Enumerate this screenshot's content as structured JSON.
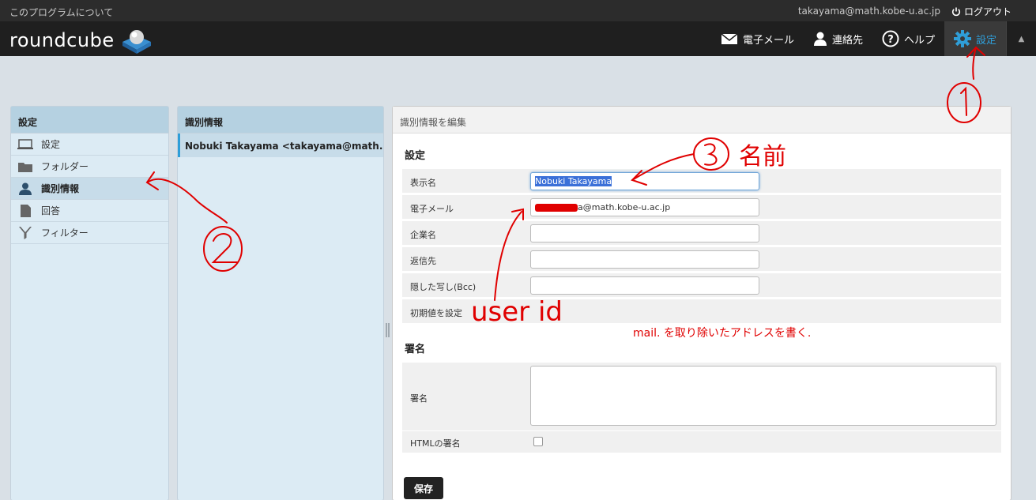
{
  "topbar": {
    "about": "このプログラムについて",
    "user_email": "takayama@math.kobe-u.ac.jp",
    "logout": "ログアウト"
  },
  "header": {
    "logo": "roundcube",
    "nav": {
      "mail": "電子メール",
      "contacts": "連絡先",
      "help": "ヘルプ",
      "settings": "設定"
    }
  },
  "settings_panel": {
    "title": "設定",
    "items": [
      {
        "label": "設定",
        "icon": "monitor-icon"
      },
      {
        "label": "フォルダー",
        "icon": "folder-icon"
      },
      {
        "label": "識別情報",
        "icon": "person-icon"
      },
      {
        "label": "回答",
        "icon": "document-icon"
      },
      {
        "label": "フィルター",
        "icon": "filter-icon"
      }
    ]
  },
  "identities_panel": {
    "title": "識別情報",
    "items": [
      "Nobuki Takayama <takayama@math...."
    ]
  },
  "editor": {
    "title": "識別情報を編集",
    "section_settings": "設定",
    "fields": {
      "display_name": {
        "label": "表示名",
        "value": "Nobuki Takayama"
      },
      "email": {
        "label": "電子メール",
        "value": "a@math.kobe-u.ac.jp"
      },
      "organization": {
        "label": "企業名",
        "value": ""
      },
      "reply_to": {
        "label": "返信先",
        "value": ""
      },
      "bcc": {
        "label": "隠した写し(Bcc)",
        "value": ""
      },
      "default": {
        "label": "初期値を設定"
      }
    },
    "section_signature": "署名",
    "signature_label": "署名",
    "html_signature_label": "HTMLの署名",
    "html_signature_checked": false,
    "save_label": "保存"
  },
  "annotations": {
    "circle_1": "①",
    "circle_2": "②",
    "circle_3": "③",
    "name": "名前",
    "user_id": "user id",
    "note": "mail. を取り除いたアドレスを書く."
  },
  "colors": {
    "accent": "#2f9ed8",
    "annotation": "#e00000",
    "header_bg": "#1f1f1f"
  }
}
